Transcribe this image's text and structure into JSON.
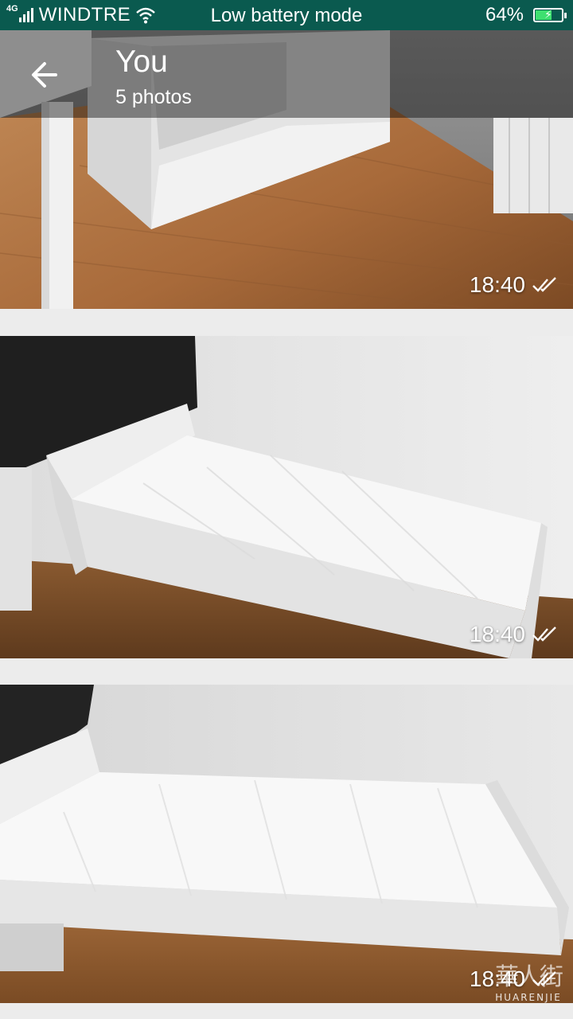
{
  "status_bar": {
    "network": "4G",
    "carrier": "WINDTRE",
    "mode": "Low battery mode",
    "battery": "64%",
    "battery_level": 0.64,
    "icons": [
      "signal-icon",
      "wifi-icon",
      "battery-icon"
    ]
  },
  "header": {
    "back_icon": "back-arrow-icon",
    "title": "You",
    "subtitle": "5 photos"
  },
  "photos": [
    {
      "time": "18:40",
      "status_icon": "double-check-icon"
    },
    {
      "time": "18:40",
      "status_icon": "double-check-icon"
    },
    {
      "time": "18:40",
      "status_icon": "double-check-icon"
    }
  ],
  "watermark": {
    "text": "HUARENJIE"
  },
  "colors": {
    "status_bar": "#0a5a4f",
    "battery_fill": "#3ee070",
    "separator": "#ececec"
  }
}
